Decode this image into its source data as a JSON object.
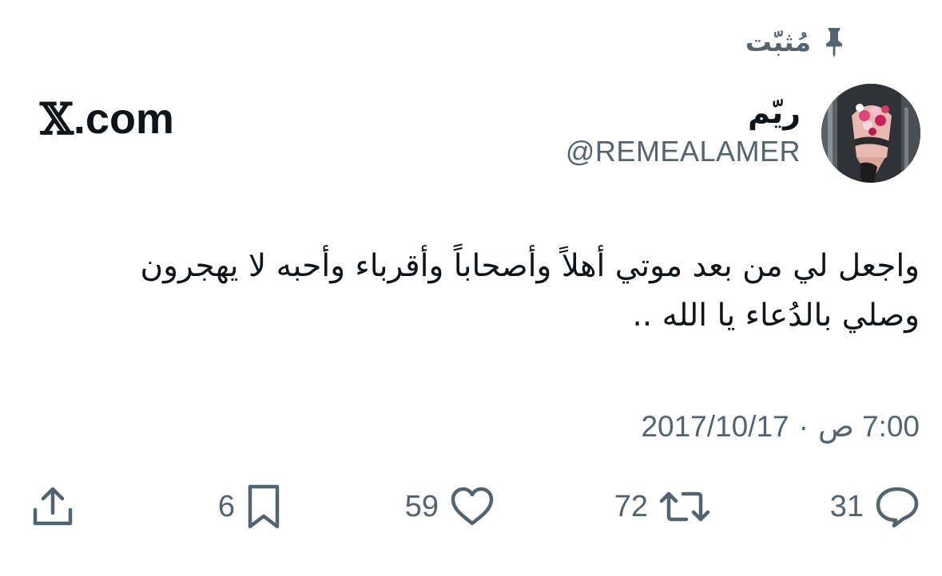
{
  "pinned": {
    "label": "مُثبّت",
    "icon": "pin-icon"
  },
  "author": {
    "display_name": "ريّم",
    "handle": "@REMEALAMER",
    "avatar_icon": "avatar-flower-bouquet"
  },
  "brand": {
    "mark": "𝕏",
    "suffix": ".com"
  },
  "tweet": {
    "lines": [
      "واجعل لي من بعد موتي أهلاً وأصحاباً وأقرباء وأحبه لا يهجرون",
      "وصلي بالدُعاء يا الله .."
    ]
  },
  "timestamp": {
    "date": "2017/10/17",
    "separator": "·",
    "time": "7:00 ص"
  },
  "actions": {
    "replies": {
      "count": "31",
      "icon": "reply-icon"
    },
    "reposts": {
      "count": "72",
      "icon": "repost-icon"
    },
    "likes": {
      "count": "59",
      "icon": "heart-icon"
    },
    "bookmarks": {
      "count": "6",
      "icon": "bookmark-icon"
    },
    "share": {
      "icon": "share-icon"
    }
  },
  "colors": {
    "text_primary": "#0f1419",
    "text_secondary": "#536471",
    "background": "#ffffff"
  }
}
